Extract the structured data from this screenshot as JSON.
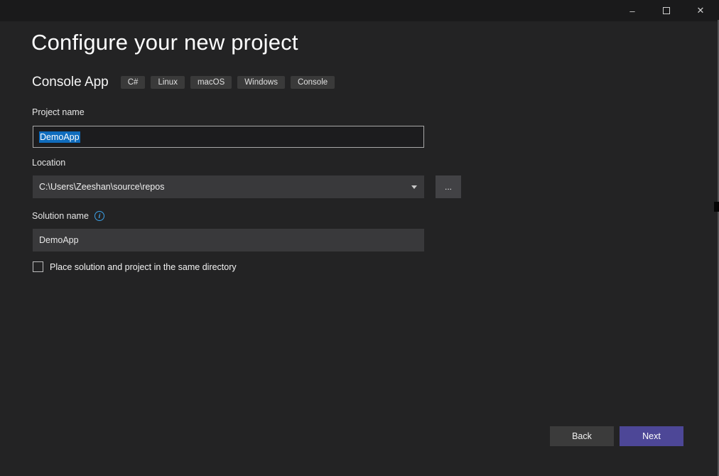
{
  "window": {
    "icons": {
      "minimize": "–",
      "close": "✕"
    }
  },
  "header": {
    "title": "Configure your new project"
  },
  "template": {
    "name": "Console App",
    "tags": [
      "C#",
      "Linux",
      "macOS",
      "Windows",
      "Console"
    ]
  },
  "form": {
    "project_name": {
      "label": "Project name",
      "value": "DemoApp"
    },
    "location": {
      "label": "Location",
      "value": "C:\\Users\\Zeeshan\\source\\repos",
      "browse_label": "..."
    },
    "solution_name": {
      "label": "Solution name",
      "info_icon": "i",
      "value": "DemoApp"
    },
    "same_directory_checkbox": {
      "label": "Place solution and project in the same directory",
      "checked": false
    }
  },
  "footer": {
    "back_label": "Back",
    "next_label": "Next"
  },
  "colors": {
    "background": "#232324",
    "titlebar": "#1a1a1b",
    "input_fill": "#39393b",
    "selection": "#0f6cbd",
    "accent_button": "#4d4797",
    "info_icon": "#3ba1e8"
  }
}
